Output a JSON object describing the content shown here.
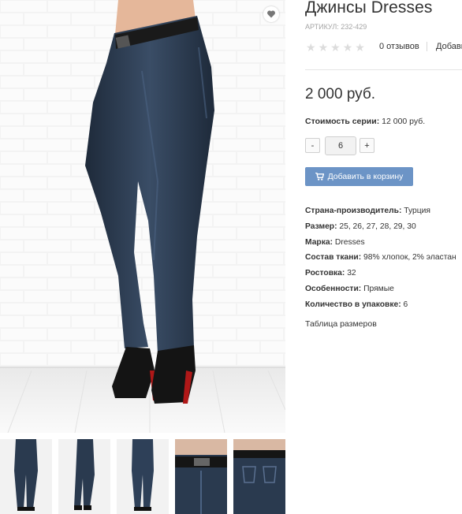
{
  "product": {
    "title": "Джинсы Dresses",
    "sku": "АРТИКУЛ: 232-429",
    "rating": 0,
    "reviews_label": "0 отзывов",
    "add_review_label": "Добавить отзыв",
    "price": "2 000 руб.",
    "series_label": "Стоимость серии:",
    "series_value": " 12 000 руб.",
    "quantity": "6",
    "qty_minus": "-",
    "qty_plus": "+",
    "cart_label": "Добавить в корзину",
    "size_table_label": "Таблица размеров",
    "specs": [
      {
        "label": "Страна-производитель:",
        "value": " Турция"
      },
      {
        "label": "Размер:",
        "value": " 25, 26, 27, 28, 29, 30"
      },
      {
        "label": "Марка:",
        "value": " Dresses"
      },
      {
        "label": "Состав ткани:",
        "value": " 98% хлопок, 2% эластан"
      },
      {
        "label": "Ростовка:",
        "value": " 32"
      },
      {
        "label": "Особенности:",
        "value": " Прямые"
      },
      {
        "label": "Количество в упаковке:",
        "value": " 6"
      }
    ]
  },
  "icons": {
    "wishlist": "heart-icon",
    "cart": "cart-icon",
    "star": "star-icon"
  },
  "colors": {
    "accent_button": "#6c94c6",
    "text": "#333333",
    "muted": "#a5a5a5",
    "star_empty": "#dcdcdc",
    "denim": "#2a3a4f"
  }
}
